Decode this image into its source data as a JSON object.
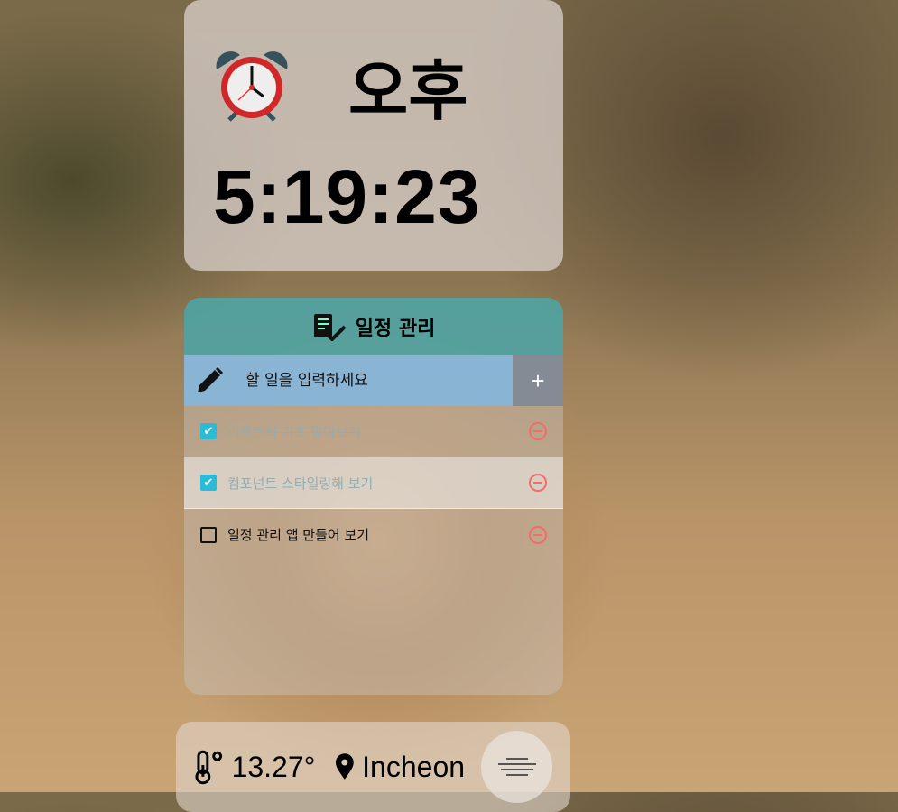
{
  "clock": {
    "ampm": "오후",
    "time": "5:19:23",
    "icon": "alarm-clock-icon"
  },
  "todo": {
    "title": "일정 관리",
    "input_placeholder": "할 일을 입력하세요",
    "add_label": "+",
    "items": [
      {
        "text": "리액트의 기초 알아보기",
        "checked": true
      },
      {
        "text": "컴포넌트 스타일링해 보기",
        "checked": true
      },
      {
        "text": "일정 관리 앱 만들어 보기",
        "checked": false
      }
    ]
  },
  "weather": {
    "temperature": "13.27°",
    "location": "Incheon",
    "condition_icon": "mist-icon"
  },
  "colors": {
    "header": "#46a0a0",
    "input_bg": "#8ab4d4",
    "check": "#2bbbd6",
    "remove": "#f26c6c"
  }
}
